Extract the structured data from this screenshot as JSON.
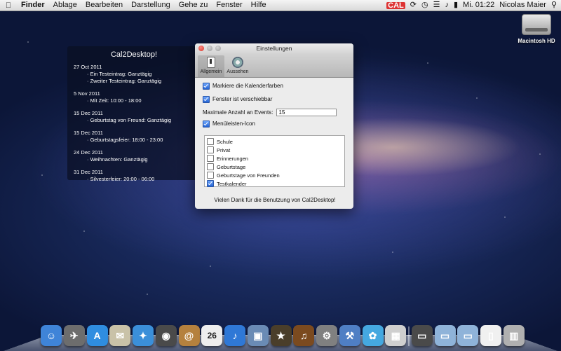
{
  "menubar": {
    "app": "Finder",
    "items": [
      "Ablage",
      "Bearbeiten",
      "Darstellung",
      "Gehe zu",
      "Fenster",
      "Hilfe"
    ],
    "status": {
      "calendar_badge": "CAL",
      "clock": "Mi. 01:22",
      "user": "Nicolas Maier"
    }
  },
  "desktop": {
    "hd_label": "Macintosh HD"
  },
  "widget": {
    "title": "Cal2Desktop!",
    "groups": [
      {
        "date": "27 Oct 2011",
        "entries": [
          "· Ein Testeintrag: Ganztägig",
          "· Zweiter Testeintrag: Ganztägig"
        ]
      },
      {
        "date": "5 Nov 2011",
        "entries": [
          "· Mit Zeit: 10:00 - 18:00"
        ]
      },
      {
        "date": "15 Dec 2011",
        "entries": [
          "· Geburtstag von Freund: Ganztägig"
        ]
      },
      {
        "date": "15 Dec 2011",
        "entries": [
          "· Geburtstagsfeier: 18:00 - 23:00"
        ]
      },
      {
        "date": "24 Dec 2011",
        "entries": [
          "· Weihnachten: Ganztägig"
        ]
      },
      {
        "date": "31 Dec 2011",
        "entries": [
          "· Silvesterfeier: 20:00 - 06:00"
        ]
      }
    ]
  },
  "prefs": {
    "title": "Einstellungen",
    "toolbar": {
      "general": "Allgemein",
      "appearance": "Aussehen"
    },
    "options": {
      "calendar_colors": {
        "label": "Markiere die Kalenderfarben",
        "checked": true
      },
      "movable": {
        "label": "Fenster ist verschiebbar",
        "checked": true
      },
      "max_events_label": "Maximale Anzahl an Events:",
      "max_events_value": "15",
      "menubar_icon": {
        "label": "Menüleisten-Icon",
        "checked": true
      }
    },
    "calendars": [
      {
        "label": "Schule",
        "checked": false
      },
      {
        "label": "Privat",
        "checked": false
      },
      {
        "label": "Erinnerungen",
        "checked": false
      },
      {
        "label": "Geburtstage",
        "checked": false
      },
      {
        "label": "Geburtstage von Freunden",
        "checked": false
      },
      {
        "label": "Testkalender",
        "checked": true
      }
    ],
    "footer": "Vielen Dank für die Benutzung von Cal2Desktop!"
  },
  "dock": {
    "apps": [
      {
        "name": "finder-icon",
        "color": "#3f84d8",
        "glyph": "☺"
      },
      {
        "name": "launchpad-icon",
        "color": "#6d6d6d",
        "glyph": "✈"
      },
      {
        "name": "app-store-icon",
        "color": "#2f8de0",
        "glyph": "A"
      },
      {
        "name": "mail-icon",
        "color": "#c9c2a8",
        "glyph": "✉"
      },
      {
        "name": "safari-icon",
        "color": "#3b8fd9",
        "glyph": "✦"
      },
      {
        "name": "facetime-icon",
        "color": "#4a4a4a",
        "glyph": "◉"
      },
      {
        "name": "address-book-icon",
        "color": "#b5813e",
        "glyph": "@"
      },
      {
        "name": "ical-icon",
        "color": "#eeeeee",
        "glyph": "26"
      },
      {
        "name": "itunes-icon",
        "color": "#2f78d6",
        "glyph": "♪"
      },
      {
        "name": "iphoto-icon",
        "color": "#6a8bb5",
        "glyph": "▣"
      },
      {
        "name": "imovie-icon",
        "color": "#4a3e2a",
        "glyph": "★"
      },
      {
        "name": "garageband-icon",
        "color": "#7b4a1f",
        "glyph": "♫"
      },
      {
        "name": "system-preferences-icon",
        "color": "#808080",
        "glyph": "⚙"
      },
      {
        "name": "xcode-icon",
        "color": "#4f7fc4",
        "glyph": "⚒"
      },
      {
        "name": "twitter-icon",
        "color": "#45a8e0",
        "glyph": "✿"
      },
      {
        "name": "calculator-icon",
        "color": "#cfcfcf",
        "glyph": "▦"
      }
    ],
    "folders": [
      {
        "name": "applications-folder-icon",
        "color": "#4a4a4a",
        "glyph": "▭"
      },
      {
        "name": "documents-folder-icon",
        "color": "#8fb3d9",
        "glyph": "▭"
      },
      {
        "name": "downloads-folder-icon",
        "color": "#8fb3d9",
        "glyph": "▭"
      },
      {
        "name": "document-stack-icon",
        "color": "#f0f0f0",
        "glyph": "▯"
      },
      {
        "name": "trash-icon",
        "color": "#b0b0b0",
        "glyph": "▥"
      }
    ]
  }
}
